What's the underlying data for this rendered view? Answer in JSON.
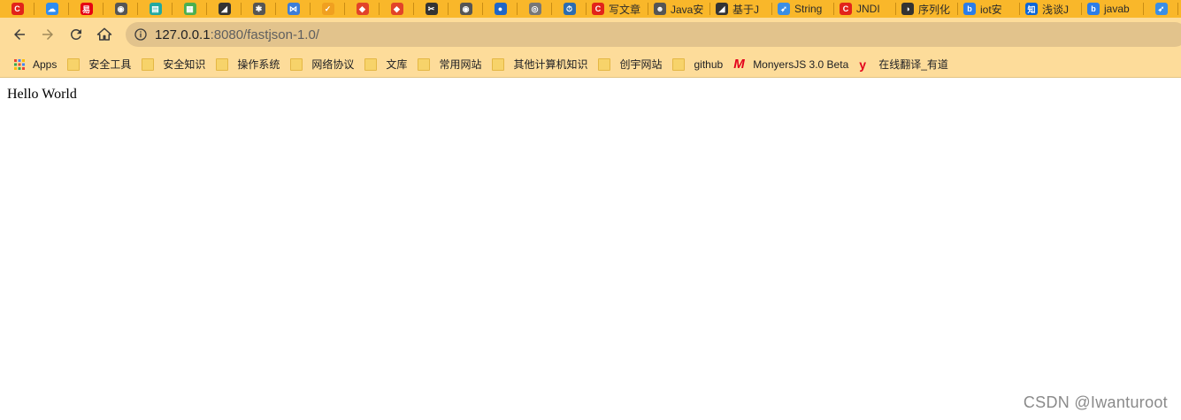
{
  "tabs": [
    {
      "icon": "csdn-icon",
      "color": "#e2231a",
      "glyph": "C",
      "title": ""
    },
    {
      "icon": "cloud-icon",
      "color": "#2f8cf0",
      "glyph": "☁",
      "title": ""
    },
    {
      "icon": "yi-icon",
      "color": "#e60012",
      "glyph": "易",
      "title": ""
    },
    {
      "icon": "globe-icon",
      "color": "#555555",
      "glyph": "◉",
      "title": ""
    },
    {
      "icon": "document-icon",
      "color": "#21a9a1",
      "glyph": "▤",
      "title": ""
    },
    {
      "icon": "board-icon",
      "color": "#4caf50",
      "glyph": "▦",
      "title": ""
    },
    {
      "icon": "zhihu-style-icon",
      "color": "#333333",
      "glyph": "◢",
      "title": ""
    },
    {
      "icon": "gear-icon",
      "color": "#555555",
      "glyph": "✱",
      "title": ""
    },
    {
      "icon": "vscode-icon",
      "color": "#3c7dd9",
      "glyph": "⋈",
      "title": ""
    },
    {
      "icon": "chrome-check-icon",
      "color": "#f0a020",
      "glyph": "✓",
      "title": ""
    },
    {
      "icon": "gitlab-icon",
      "color": "#e24329",
      "glyph": "◆",
      "title": ""
    },
    {
      "icon": "gitlab-icon",
      "color": "#e24329",
      "glyph": "◆",
      "title": ""
    },
    {
      "icon": "scissors-icon",
      "color": "#333333",
      "glyph": "✂",
      "title": ""
    },
    {
      "icon": "globe-icon",
      "color": "#555555",
      "glyph": "◉",
      "title": ""
    },
    {
      "icon": "app-icon",
      "color": "#1e66c8",
      "glyph": "●",
      "title": ""
    },
    {
      "icon": "eye-icon",
      "color": "#777777",
      "glyph": "◎",
      "title": ""
    },
    {
      "icon": "clock-icon",
      "color": "#2b6cb0",
      "glyph": "⏱",
      "title": ""
    },
    {
      "icon": "csdn-icon",
      "color": "#e2231a",
      "glyph": "C",
      "title": "写文章"
    },
    {
      "icon": "avatar-icon",
      "color": "#555555",
      "glyph": "☻",
      "title": "Java安"
    },
    {
      "icon": "zhihu-style-icon",
      "color": "#333333",
      "glyph": "◢",
      "title": "基于J"
    },
    {
      "icon": "rocket-icon",
      "color": "#3a8ee6",
      "glyph": "➶",
      "title": "String"
    },
    {
      "icon": "csdn-icon",
      "color": "#e2231a",
      "glyph": "C",
      "title": "JNDI"
    },
    {
      "icon": "github-icon",
      "color": "#333333",
      "glyph": "◑",
      "title": "序列化"
    },
    {
      "icon": "bing-icon",
      "color": "#2b7de9",
      "glyph": "b",
      "title": "iot安"
    },
    {
      "icon": "zhihu-icon",
      "color": "#0a66d8",
      "glyph": "知",
      "title": "浅谈J"
    },
    {
      "icon": "bing-icon",
      "color": "#2b7de9",
      "glyph": "b",
      "title": "javab"
    },
    {
      "icon": "rocket-icon",
      "color": "#3a8ee6",
      "glyph": "➶",
      "title": ""
    }
  ],
  "toolbar": {
    "url_host": "127.0.0.1",
    "url_rest": ":8080/fastjson-1.0/"
  },
  "bookmarks": [
    {
      "label": "Apps",
      "icon": "apps-grid-icon"
    },
    {
      "label": "安全工具",
      "icon": "folder-icon"
    },
    {
      "label": "安全知识",
      "icon": "folder-icon"
    },
    {
      "label": "操作系统",
      "icon": "folder-icon"
    },
    {
      "label": "网络协议",
      "icon": "folder-icon"
    },
    {
      "label": "文库",
      "icon": "folder-icon"
    },
    {
      "label": "常用网站",
      "icon": "folder-icon"
    },
    {
      "label": "其他计算机知识",
      "icon": "folder-icon"
    },
    {
      "label": "创宇网站",
      "icon": "folder-icon"
    },
    {
      "label": "github",
      "icon": "folder-icon"
    },
    {
      "label": "MonyersJS 3.0 Beta",
      "icon": "monyers-m-icon"
    },
    {
      "label": "在线翻译_有道",
      "icon": "youdao-icon"
    }
  ],
  "page": {
    "body_text": "Hello World"
  },
  "watermark": "CSDN @Iwanturoot",
  "colors": {
    "tabstrip": "#f9b72a",
    "toolbar": "#fddc9a",
    "omnibox": "#e2c38c"
  }
}
